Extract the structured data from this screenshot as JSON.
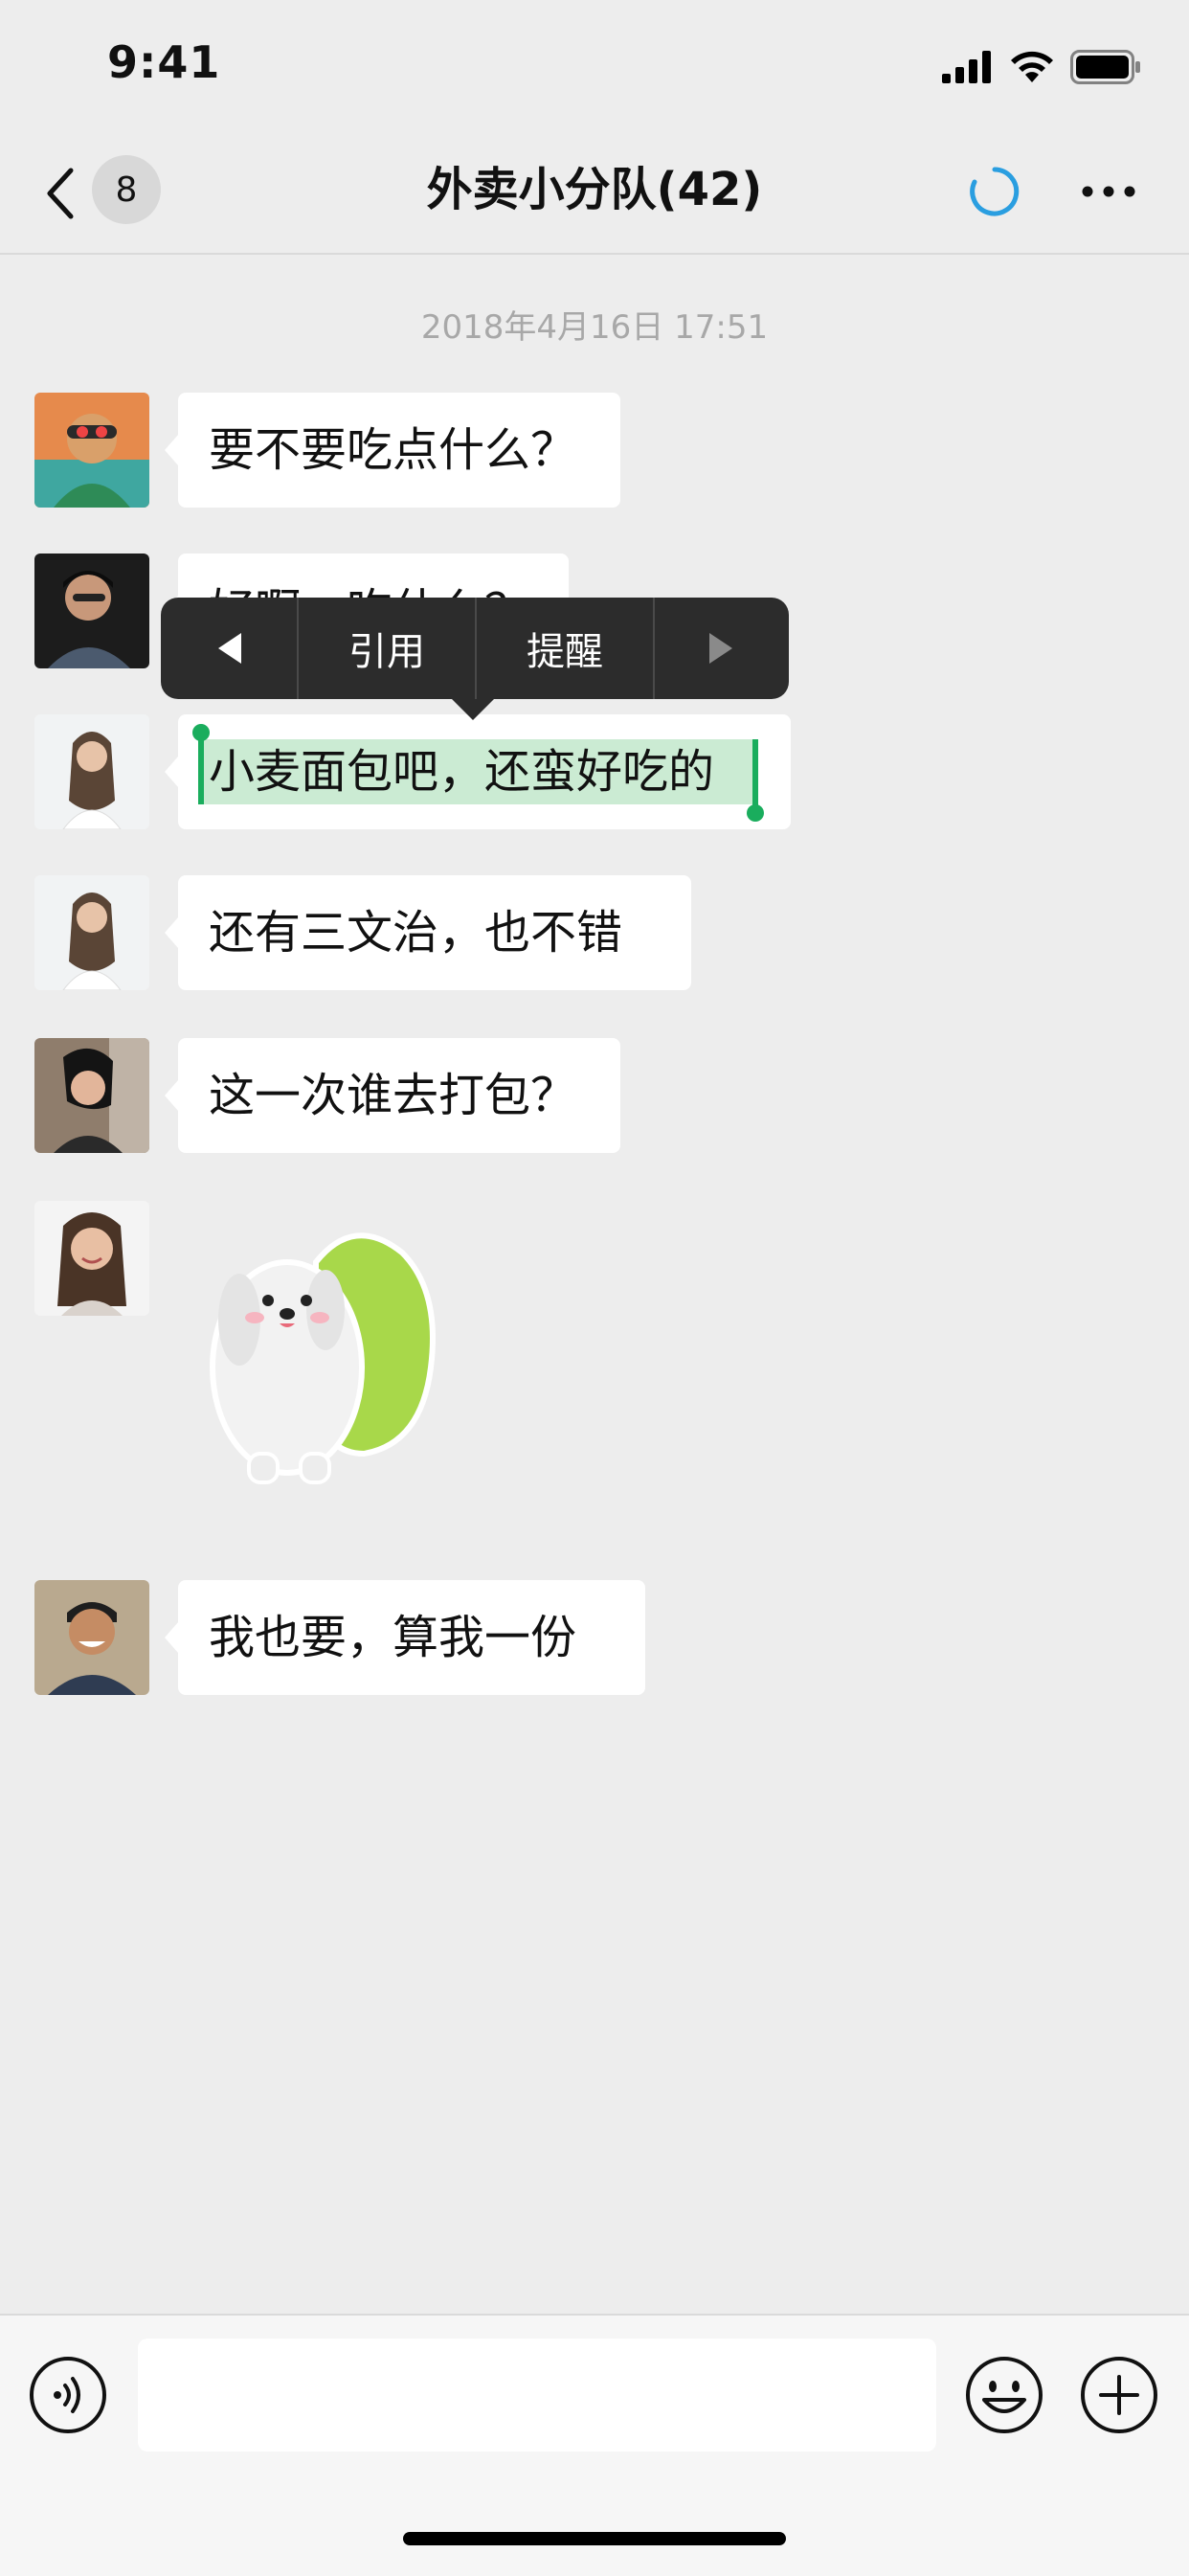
{
  "status_bar": {
    "time": "9:41"
  },
  "nav": {
    "unread_count": "8",
    "title": "外卖小分队(42)"
  },
  "chat": {
    "timestamp": "2018年4月16日 17:51",
    "messages": [
      {
        "text": "要不要吃点什么？"
      },
      {
        "text": "好啊，吃什么？"
      },
      {
        "text": "小麦面包吧，还蛮好吃的"
      },
      {
        "text": "还有三文治，也不错"
      },
      {
        "text": "这一次谁去打包？"
      },
      {
        "type": "sticker"
      },
      {
        "text": "我也要，算我一份"
      }
    ]
  },
  "context_menu": {
    "items": [
      "引用",
      "提醒"
    ]
  },
  "input_bar": {
    "placeholder": ""
  },
  "colors": {
    "accent_green": "#1AAD5D",
    "spinner_blue": "#2A9EE0",
    "background": "#EDEDED"
  }
}
